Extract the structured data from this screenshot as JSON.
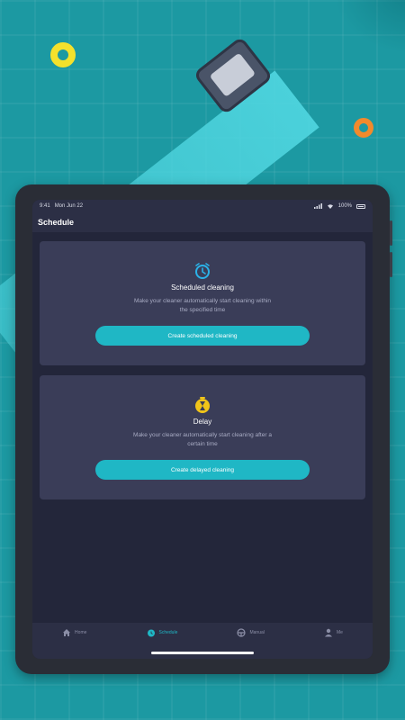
{
  "status": {
    "time": "9:41",
    "date": "Mon Jun 22",
    "battery": "100%"
  },
  "header": {
    "title": "Schedule"
  },
  "cards": [
    {
      "title": "Scheduled cleaning",
      "description": "Make your cleaner automatically start cleaning within the specified time",
      "button": "Create scheduled cleaning",
      "icon": "alarm-clock-icon",
      "icon_color": "#2bb2e8"
    },
    {
      "title": "Delay",
      "description": "Make your cleaner automatically start cleaning after a certain time",
      "button": "Create delayed cleaning",
      "icon": "hourglass-timer-icon",
      "icon_color": "#f0c419"
    }
  ],
  "nav": {
    "items": [
      {
        "label": "Home",
        "icon": "home-icon"
      },
      {
        "label": "Schedule",
        "icon": "schedule-icon",
        "active": true
      },
      {
        "label": "Manual",
        "icon": "steering-icon"
      },
      {
        "label": "Me",
        "icon": "person-icon"
      }
    ]
  },
  "colors": {
    "accent": "#1fb7c5",
    "background_pool": "#1c99a2",
    "screen_bg": "#23263a",
    "card_bg": "#3a3d58"
  }
}
